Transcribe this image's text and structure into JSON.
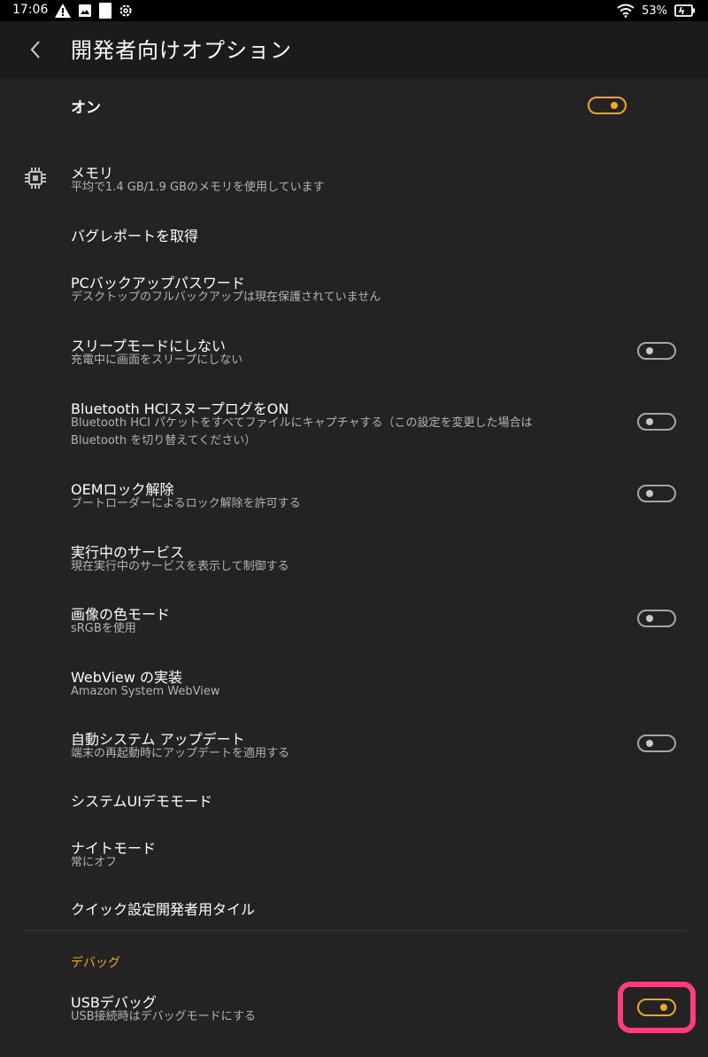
{
  "status_bar": {
    "time": "17:06",
    "battery": "53%",
    "icons_left": [
      "warning-icon",
      "image-icon",
      "square-icon",
      "settings-icon"
    ],
    "icons_right": [
      "wifi-icon",
      "battery-icon"
    ]
  },
  "app_bar": {
    "title": "開発者向けオプション",
    "back_icon": "chevron-left-icon"
  },
  "master": {
    "label": "オン",
    "enabled": true
  },
  "rows": [
    {
      "id": "memory",
      "title": "メモリ",
      "subtitle": "平均で1.4 GB/1.9 GBのメモリを使用しています",
      "icon": "memory-chip-icon"
    },
    {
      "id": "bugreport",
      "title": "バグレポートを取得"
    },
    {
      "id": "pc-backup",
      "title": "PCバックアップパスワード",
      "subtitle": "デスクトップのフルバックアップは現在保護されていません"
    },
    {
      "id": "stay-awake",
      "title": "スリープモードにしない",
      "subtitle": "充電中に画面をスリープにしない",
      "toggle": false
    },
    {
      "id": "bt-hci",
      "title": "Bluetooth HCIスヌープログをON",
      "subtitle": "Bluetooth HCI パケットをすべてファイルにキャプチャする（この設定を変更した場合は Bluetooth を切り替えてください）",
      "toggle": false
    },
    {
      "id": "oem-unlock",
      "title": "OEMロック解除",
      "subtitle": "ブートローダーによるロック解除を許可する",
      "toggle": false
    },
    {
      "id": "running-services",
      "title": "実行中のサービス",
      "subtitle": "現在実行中のサービスを表示して制御する"
    },
    {
      "id": "color-mode",
      "title": "画像の色モード",
      "subtitle": "sRGBを使用",
      "toggle": false
    },
    {
      "id": "webview",
      "title": "WebView の実装",
      "subtitle": "Amazon System WebView"
    },
    {
      "id": "auto-update",
      "title": "自動システム アップデート",
      "subtitle": "端末の再起動時にアップデートを適用する",
      "toggle": false
    },
    {
      "id": "demo-mode",
      "title": "システムUIデモモード"
    },
    {
      "id": "night-mode",
      "title": "ナイトモード",
      "subtitle": "常にオフ"
    },
    {
      "id": "quick-tiles",
      "title": "クイック設定開発者用タイル"
    }
  ],
  "debug_section": {
    "header": "デバッグ",
    "usb_debugging": {
      "title": "USBデバッグ",
      "subtitle": "USB接続時はデバッグモードにする",
      "toggle": true
    }
  },
  "colors": {
    "background": "#232323",
    "app_bar": "#1b1b1b",
    "accent": "#f6a623",
    "highlight": "#ff3d7f"
  }
}
